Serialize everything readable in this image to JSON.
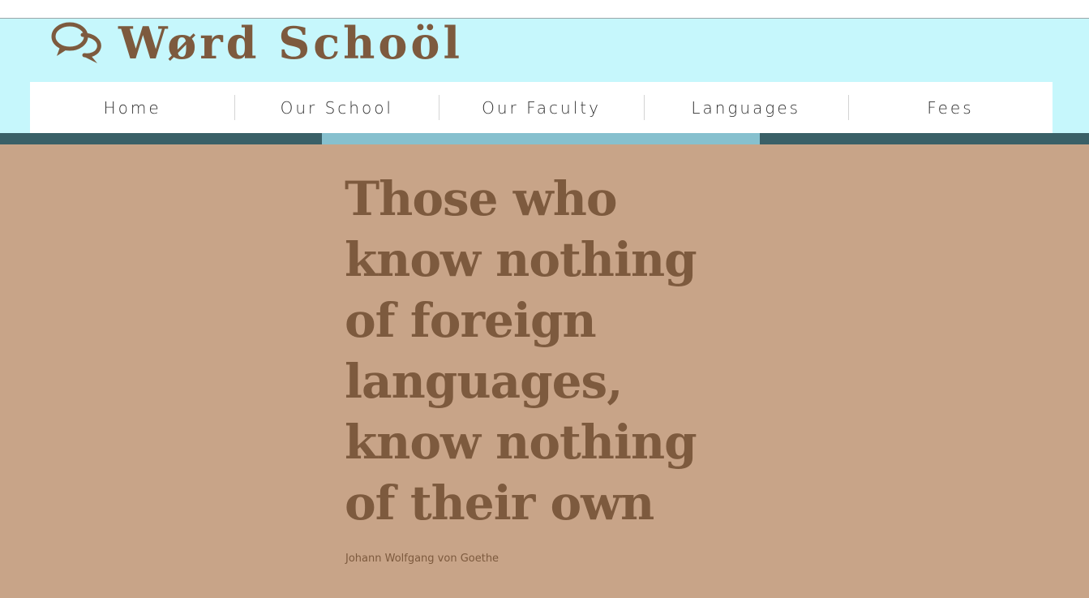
{
  "site": {
    "brand_name": "Wørd Schoöl",
    "logo_icon": "speech-bubbles-icon"
  },
  "nav": {
    "items": [
      {
        "label": "Home"
      },
      {
        "label": "Our School"
      },
      {
        "label": "Our Faculty"
      },
      {
        "label": "Languages"
      },
      {
        "label": "Fees"
      }
    ]
  },
  "hero": {
    "quote": "Those who know nothing of foreign languages, know nothing of their own",
    "author": "Johann Wolfgang von Goethe"
  },
  "colors": {
    "header_bg": "#c6f7fc",
    "brand_brown": "#7d5a3e",
    "band_dark": "#3a6067",
    "band_accent": "#86c0ce",
    "content_bg": "#c8a488"
  }
}
